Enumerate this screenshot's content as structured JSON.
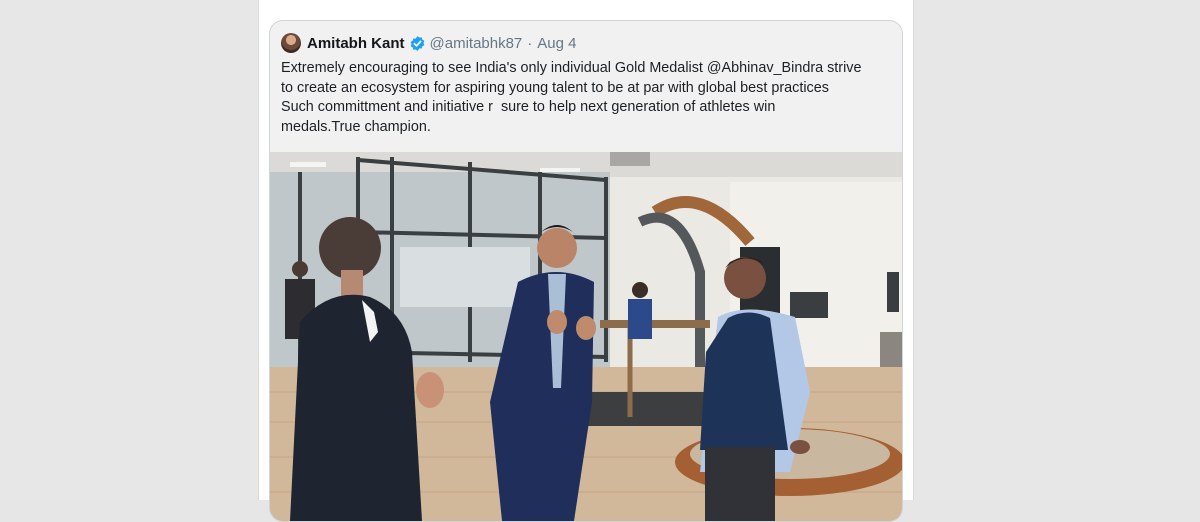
{
  "tweet": {
    "author_name": "Amitabh Kant",
    "handle": "@amitabhk87",
    "separator": "·",
    "date": "Aug 4",
    "text": "Extremely encouraging to see India's only individual Gold Medalist @Abhinav_Bindra strive\nto create an ecosystem for aspiring young talent to be at par with global best practices\nSuch committment and initiative r  sure to help next generation of athletes win\nmedals.True champion."
  },
  "icons": {
    "verified": "verified-badge-icon",
    "avatar": "profile-avatar"
  },
  "colors": {
    "verified_blue": "#1da1f2",
    "card_background": "#f1f1f1",
    "page_background": "#e7e7e7"
  }
}
